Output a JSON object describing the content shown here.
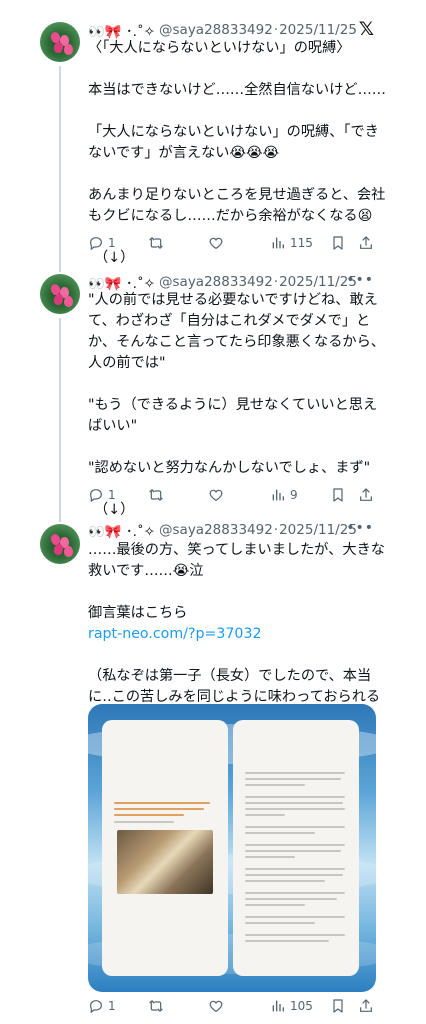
{
  "tweets": [
    {
      "display_name": "👀🎀 ･.˚✧",
      "handle": "@saya28833492",
      "date": "2025/11/25",
      "paragraphs": [
        "〈「大人にならないといけない」の呪縛〉",
        "本当はできないけど……全然自信ないけど……",
        "「大人にならないといけない」の呪縛、「できないです」が言えない😭😭😭",
        "あんまり足りないところを見せ過ぎると、会社もクビになるし……だから余裕がなくなる😫",
        "（↓）"
      ],
      "replies": "1",
      "views": "115"
    },
    {
      "display_name": "👀🎀 ･.˚✧",
      "handle": "@saya28833492",
      "date": "2025/11/25",
      "paragraphs": [
        "\"人の前では見せる必要ないですけどね、敢えて、わざわざ「自分はこれダメでダメで」とか、そんなこと言ってたら印象悪くなるから、人の前では\"",
        "\"もう（できるように）見せなくていいと思えばいい\"",
        "\"認めないと努力なんかしないでしょ、まず\"",
        "（↓）"
      ],
      "replies": "1",
      "views": "9"
    },
    {
      "display_name": "👀🎀 ･.˚✧",
      "handle": "@saya28833492",
      "date": "2025/11/25",
      "paragraphs": [
        "……最後の方、笑ってしまいましたが、大きな救いです……😭泣",
        "御言葉はこちら",
        "rapt-neo.com/?p=37032",
        "（私なぞは第一子（長女）でしたので、本当に‥この苦しみを同じように味わっておられる方が、少しでも救われますように‥）"
      ],
      "replies": "1",
      "views": "105"
    }
  ],
  "icons": {
    "reply": "reply-icon",
    "retweet": "retweet-icon",
    "like": "like-icon",
    "views": "views-icon",
    "bookmark": "bookmark-icon",
    "share": "share-icon",
    "x_logo": "x-logo-icon",
    "more": "more-icon"
  },
  "colors": {
    "link": "#1d9bf0",
    "secondary_text": "#536471",
    "primary_text": "#0f1419",
    "thread_line": "#cfd9de"
  }
}
